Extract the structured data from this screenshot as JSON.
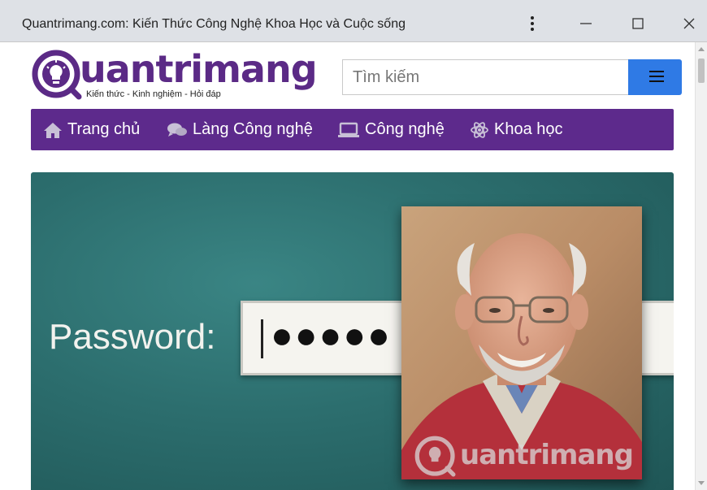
{
  "window": {
    "title": "Quantrimang.com: Kiến Thức Công Nghệ Khoa Học và Cuộc sống",
    "menu_icon": "more-vert-icon",
    "minimize_icon": "minimize-icon",
    "maximize_icon": "maximize-icon",
    "close_icon": "close-icon"
  },
  "header": {
    "logo_word": "uantrimang",
    "logo_tagline": "Kiến thức - Kinh nghiệm - Hỏi đáp",
    "search_placeholder": "Tìm kiếm",
    "search_value": ""
  },
  "nav": {
    "items": [
      {
        "label": "Trang chủ",
        "icon": "home-icon"
      },
      {
        "label": "Làng Công nghệ",
        "icon": "chat-bubbles-icon"
      },
      {
        "label": "Công nghệ",
        "icon": "laptop-icon"
      },
      {
        "label": "Khoa học",
        "icon": "atom-icon"
      }
    ]
  },
  "hero": {
    "password_label": "Password:",
    "password_dots": "●●●●●",
    "watermark": "uantrimang"
  },
  "colors": {
    "brand_purple": "#5d2a8c",
    "search_blue": "#2f7ae5",
    "hero_teal": "#2c6e6e"
  }
}
